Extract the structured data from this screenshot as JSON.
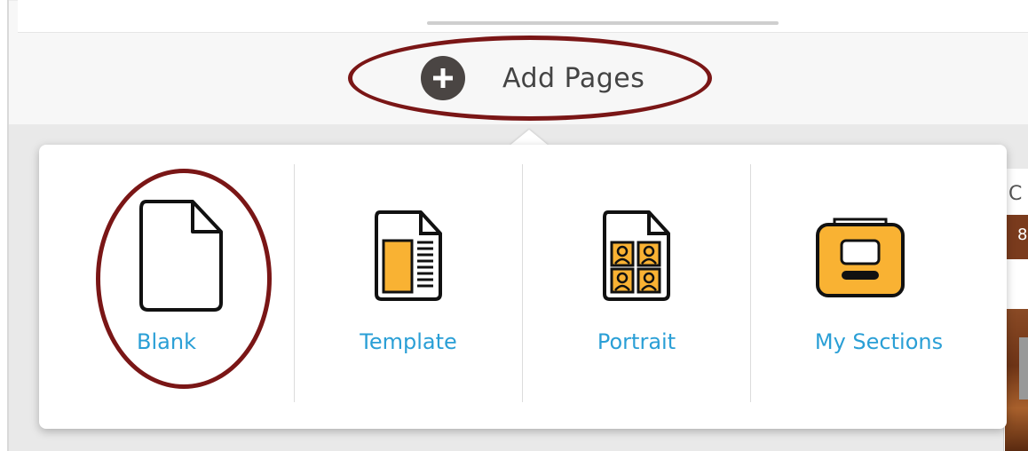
{
  "header": {
    "add_pages_label": "Add Pages",
    "plus_icon": "plus-circle-icon"
  },
  "popup": {
    "options": [
      {
        "label": "Blank",
        "icon": "blank-page-icon"
      },
      {
        "label": "Template",
        "icon": "template-page-icon"
      },
      {
        "label": "Portrait",
        "icon": "portrait-page-icon"
      },
      {
        "label": "My Sections",
        "icon": "my-sections-icon"
      }
    ]
  },
  "side_panel": {
    "partial_text_1": "C",
    "partial_text_2": "8"
  },
  "colors": {
    "accent_text": "#2a9fd6",
    "highlight_ring": "#7a1616",
    "icon_fill": "#f9b233",
    "plus_bg": "#4a4543"
  }
}
